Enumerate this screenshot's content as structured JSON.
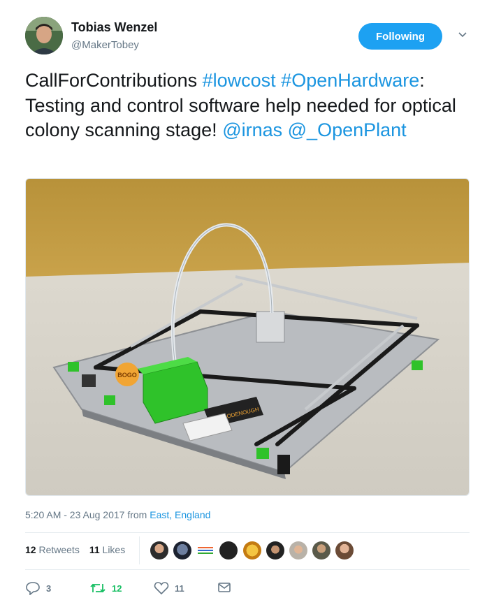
{
  "author": {
    "name": "Tobias Wenzel",
    "handle": "@MakerTobey"
  },
  "follow_label": "Following",
  "tweet": {
    "segments": [
      {
        "text": "CallForContributions ",
        "link": false
      },
      {
        "text": "#lowcost",
        "link": true
      },
      {
        "text": " ",
        "link": false
      },
      {
        "text": "#OpenHardware",
        "link": true
      },
      {
        "text": ": Testing and control software help needed for optical colony scanning stage! ",
        "link": false
      },
      {
        "text": "@irnas",
        "link": true
      },
      {
        "text": " ",
        "link": false
      },
      {
        "text": "@_OpenPlant",
        "link": true
      }
    ]
  },
  "meta": {
    "time": "5:20 AM - 23 Aug 2017",
    "from_label": " from ",
    "location": "East, England"
  },
  "stats": {
    "retweets_count": "12",
    "retweets_label": " Retweets",
    "likes_count": "11",
    "likes_label": " Likes"
  },
  "actions": {
    "replies": "3",
    "retweets": "12",
    "likes": "11"
  },
  "colors": {
    "accent": "#1da1f2",
    "link": "#1b95e0",
    "retweet_green": "#17bf63",
    "muted": "#657786"
  },
  "photo_labels": {
    "sticker": "BOGO",
    "brand": "GOODENOUGH"
  }
}
